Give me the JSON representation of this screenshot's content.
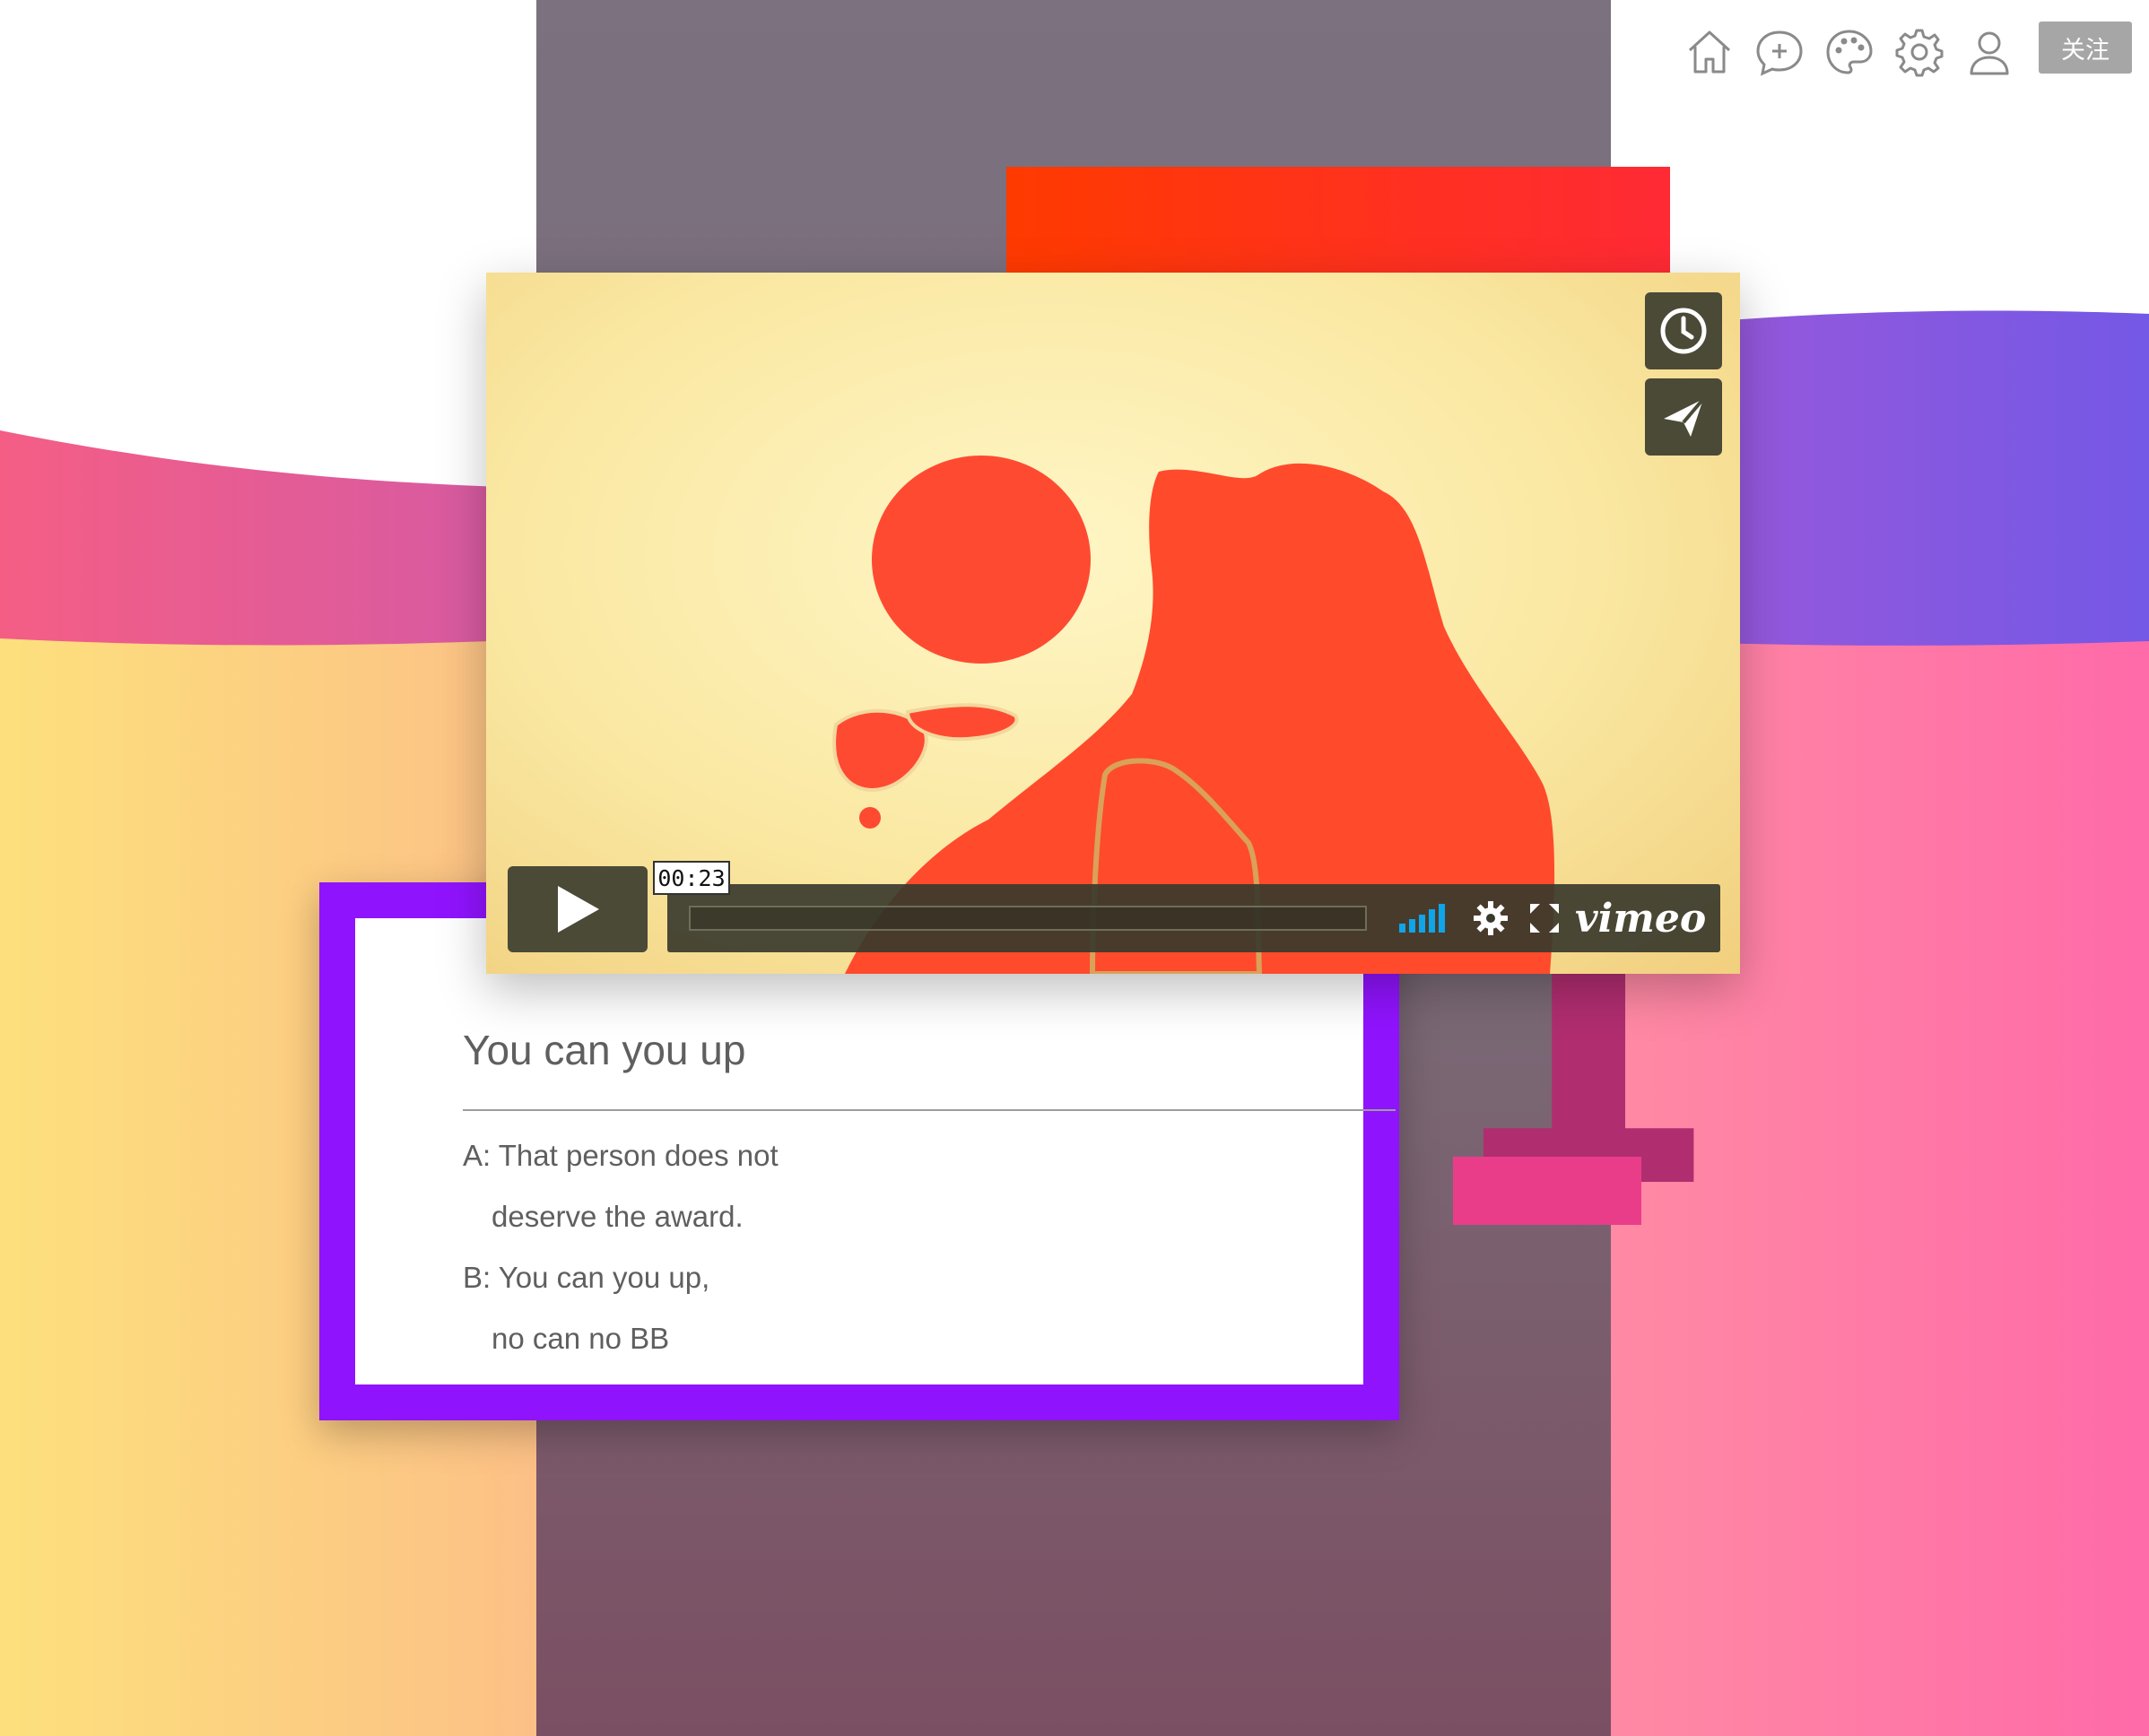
{
  "toolbar": {
    "icons": [
      "home-icon",
      "chat-add-icon",
      "palette-icon",
      "gear-icon",
      "user-icon"
    ],
    "follow_label": "关注"
  },
  "video": {
    "time_tooltip": "00:23",
    "brand": "vimeo",
    "side_buttons": [
      "clock-icon",
      "send-icon"
    ],
    "controls": [
      "play-icon",
      "volume-icon",
      "settings-icon",
      "fullscreen-icon"
    ],
    "accent_color": "#0ea5e9"
  },
  "card": {
    "title": "You can you up",
    "lines": [
      {
        "speaker": "A:",
        "text": "That person does not"
      },
      {
        "speaker": "",
        "text": "deserve the award."
      },
      {
        "speaker": "B:",
        "text": "You can you up,"
      },
      {
        "speaker": "",
        "text": "no can no BB"
      }
    ]
  },
  "decor": {
    "digit_first": "0",
    "digit_second": "1"
  },
  "colors": {
    "card_border": "#9013fe",
    "center_column": "#7b717f",
    "wave_left": "#f0558c",
    "wave_right": "#7b5be8"
  }
}
